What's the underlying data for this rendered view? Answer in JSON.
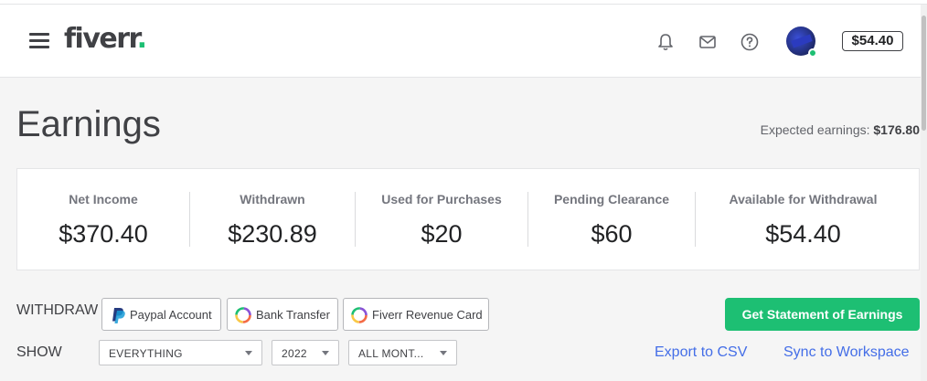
{
  "header": {
    "logo_text": "fiverr",
    "logo_dot": ".",
    "balance": "$54.40",
    "icons": [
      "menu-icon",
      "bell-icon",
      "mail-icon",
      "help-icon",
      "avatar"
    ]
  },
  "page": {
    "title": "Earnings",
    "expected_label": "Expected earnings: ",
    "expected_value": "$176.80"
  },
  "stats": [
    {
      "label": "Net Income",
      "value": "$370.40"
    },
    {
      "label": "Withdrawn",
      "value": "$230.89"
    },
    {
      "label": "Used for Purchases",
      "value": "$20"
    },
    {
      "label": "Pending Clearance",
      "value": "$60"
    },
    {
      "label": "Available for Withdrawal",
      "value": "$54.40"
    }
  ],
  "withdraw": {
    "label": "WITHDRAW",
    "options": [
      {
        "label": "Paypal Account",
        "icon": "paypal-icon"
      },
      {
        "label": "Bank Transfer",
        "icon": "ring-icon"
      },
      {
        "label": "Fiverr Revenue Card",
        "icon": "ring-icon"
      }
    ],
    "statement_button": "Get Statement of Earnings"
  },
  "show": {
    "label": "SHOW",
    "filters": [
      {
        "value": "EVERYTHING"
      },
      {
        "value": "2022"
      },
      {
        "value": "ALL MONT..."
      }
    ],
    "export_link": "Export to CSV",
    "sync_link": "Sync to Workspace"
  },
  "colors": {
    "brand": "#1dbf73",
    "text": "#404145",
    "link": "#446ee7"
  }
}
